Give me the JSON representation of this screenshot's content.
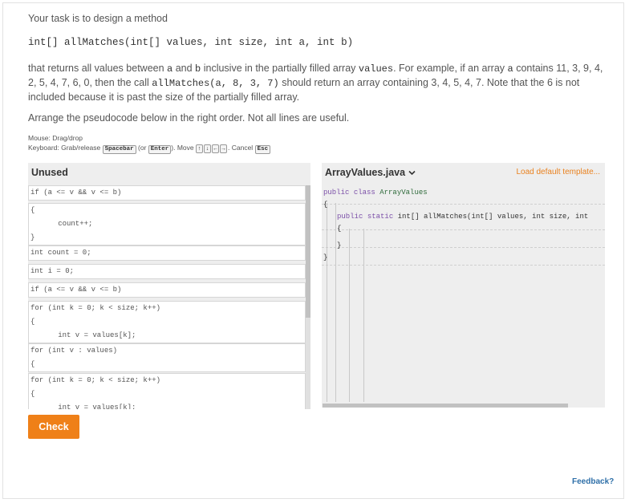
{
  "intro": "Your task is to design a method",
  "signature": "int[] allMatches(int[] values, int size, int a, int b)",
  "description": {
    "part1": "that returns all values between ",
    "a1": "a",
    "and": " and ",
    "b1": "b",
    "part2": " inclusive in the partially filled array ",
    "values": "values",
    "part3": ". For example, if an array ",
    "a2": "a",
    "part4": " contains 11, 3, 9, 4, 2, 5, 4, 7, 6, 0, then the call ",
    "call": "allMatches(a, 8, 3, 7)",
    "part5": " should return an array containing 3, 4, 5, 4, 7. Note that the 6 is not included because it is past the size of the partially filled array."
  },
  "arrange": "Arrange the pseudocode below in the right order. Not all lines are useful.",
  "help": {
    "mouse": "Mouse: Drag/drop",
    "keyboard_prefix": "Keyboard: Grab/release",
    "spacebar": "Spacebar",
    "or": "(or",
    "enter": "Enter",
    "move": "). Move",
    "arrows": [
      "↑",
      "↓",
      "←",
      "→"
    ],
    "cancel": ". Cancel",
    "esc": "Esc"
  },
  "unused": {
    "title": "Unused",
    "blocks": [
      {
        "lines": [
          "if (a <= v && v <= b)"
        ]
      },
      {
        "lines": [
          "{",
          "   count++;",
          "}"
        ]
      },
      {
        "lines": [
          "int count = 0;"
        ]
      },
      {
        "lines": [
          "int i = 0;"
        ]
      },
      {
        "lines": [
          "if (a <= v && v <= b)"
        ]
      },
      {
        "lines": [
          "for (int k = 0; k < size; k++)",
          "{",
          "   int v = values[k];"
        ]
      },
      {
        "lines": [
          "for (int v : values)",
          "{"
        ]
      },
      {
        "lines": [
          "for (int k = 0; k < size; k++)",
          "{",
          "   int v = values[k];"
        ]
      }
    ]
  },
  "editor": {
    "filename": "ArrayValues.java",
    "load_default": "Load default template...",
    "code": {
      "l1_kw1": "public",
      "l1_kw2": "class",
      "l1_name": "ArrayValues",
      "l2": "{",
      "l3_kw1": "public",
      "l3_kw2": "static",
      "l3_rest": "int[] allMatches(int[] values, int size, int",
      "l4": "{",
      "l5": "}",
      "l6": "}"
    }
  },
  "check_label": "Check",
  "feedback_label": "Feedback?",
  "colors": {
    "accent": "#ef8018",
    "link": "#2e6fa8",
    "load_default": "#e98220"
  }
}
